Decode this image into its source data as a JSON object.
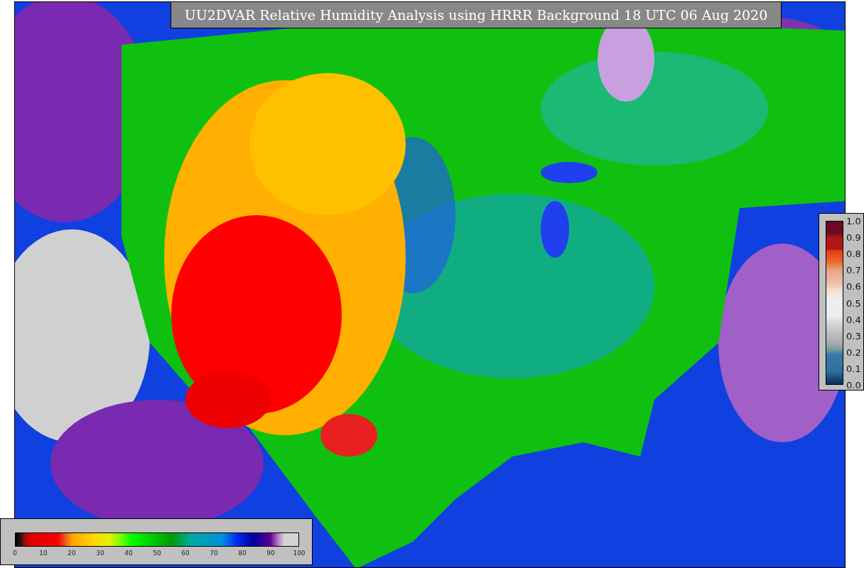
{
  "title": "UU2DVAR Relative Humidity Analysis using HRRR Background 18 UTC 06 Aug 2020",
  "observation_colorbar": {
    "labels": [
      "1.0",
      "0.9",
      "0.8",
      "0.7",
      "0.6",
      "0.5",
      "0.4",
      "0.3",
      "0.2",
      "0.1",
      "0.0"
    ]
  },
  "analysis_colorbar": {
    "labels": [
      "0",
      "10",
      "20",
      "30",
      "40",
      "50",
      "60",
      "70",
      "80",
      "90",
      "100"
    ]
  }
}
